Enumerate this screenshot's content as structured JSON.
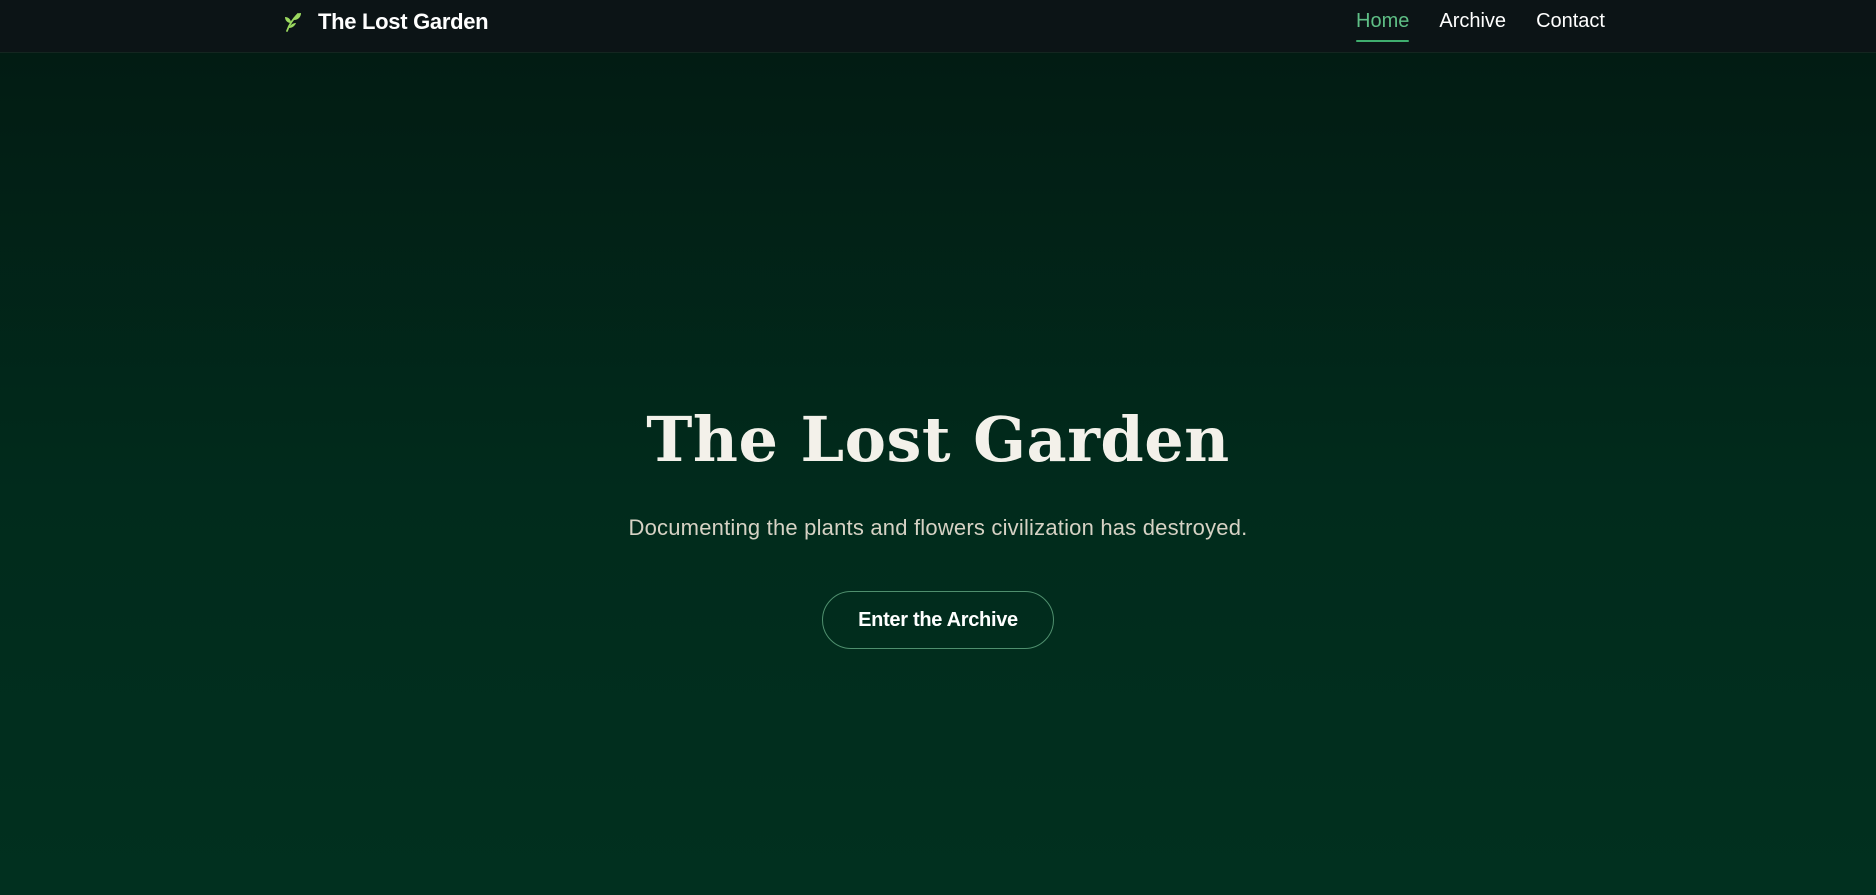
{
  "header": {
    "brand": {
      "icon": "sprout-icon",
      "icon_color": "#9bd85f",
      "title": "The Lost Garden"
    },
    "nav": [
      {
        "label": "Home",
        "active": true
      },
      {
        "label": "Archive",
        "active": false
      },
      {
        "label": "Contact",
        "active": false
      }
    ]
  },
  "hero": {
    "title": "The Lost Garden",
    "subtitle": "Documenting the plants and flowers civilization has destroyed.",
    "cta_label": "Enter the Archive"
  },
  "colors": {
    "header_bg": "#0c1416",
    "hero_bg_top": "#021a12",
    "hero_bg_bottom": "#01301f",
    "accent": "#5fbf86",
    "cta_border": "#4f8f6e",
    "subtitle": "#d6d2c4"
  }
}
